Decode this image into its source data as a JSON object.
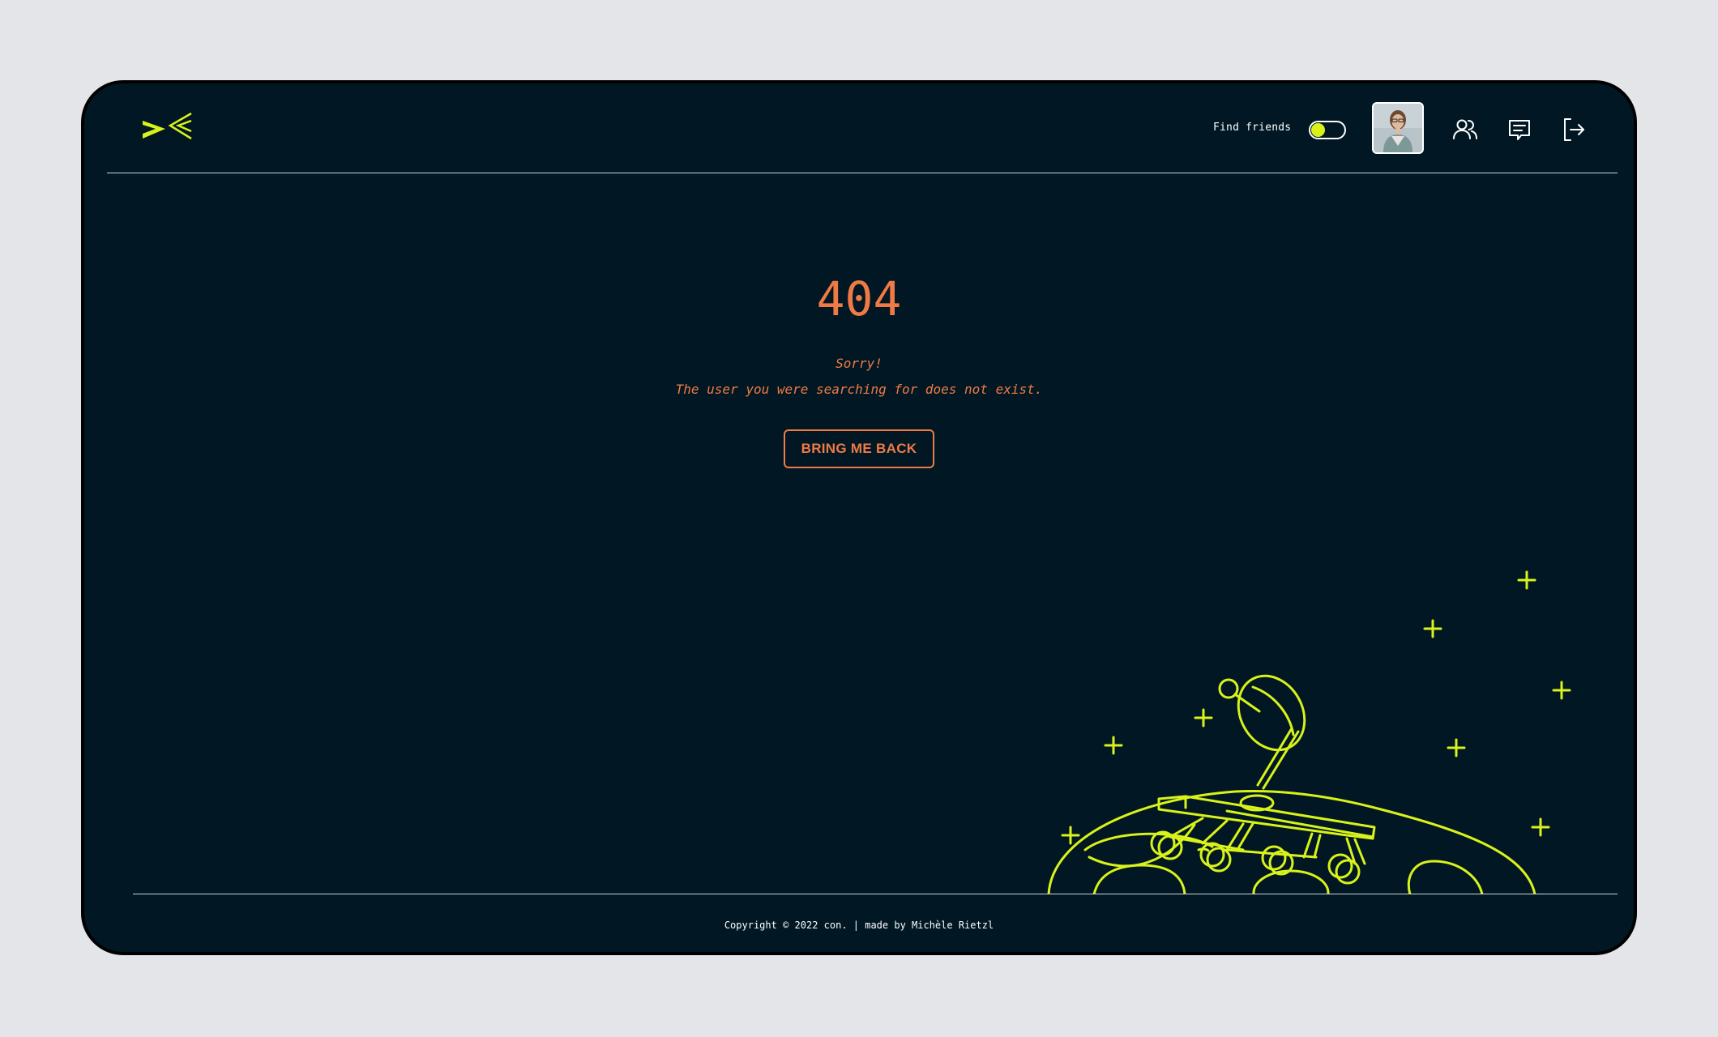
{
  "header": {
    "find_friends_label": "Find friends",
    "toggle_on": true,
    "icons": [
      "users-icon",
      "chat-icon",
      "logout-icon"
    ]
  },
  "error": {
    "code": "404",
    "sorry": "Sorry!",
    "message": "The user you were searching for does not exist.",
    "button_label": "BRING ME BACK"
  },
  "footer": {
    "copyright": "Copyright © 2022 con. | made by Michèle Rietzl"
  },
  "colors": {
    "background": "#011824",
    "accent": "#d9f21a",
    "error": "#f07a45",
    "page": "#e3e5e9"
  }
}
